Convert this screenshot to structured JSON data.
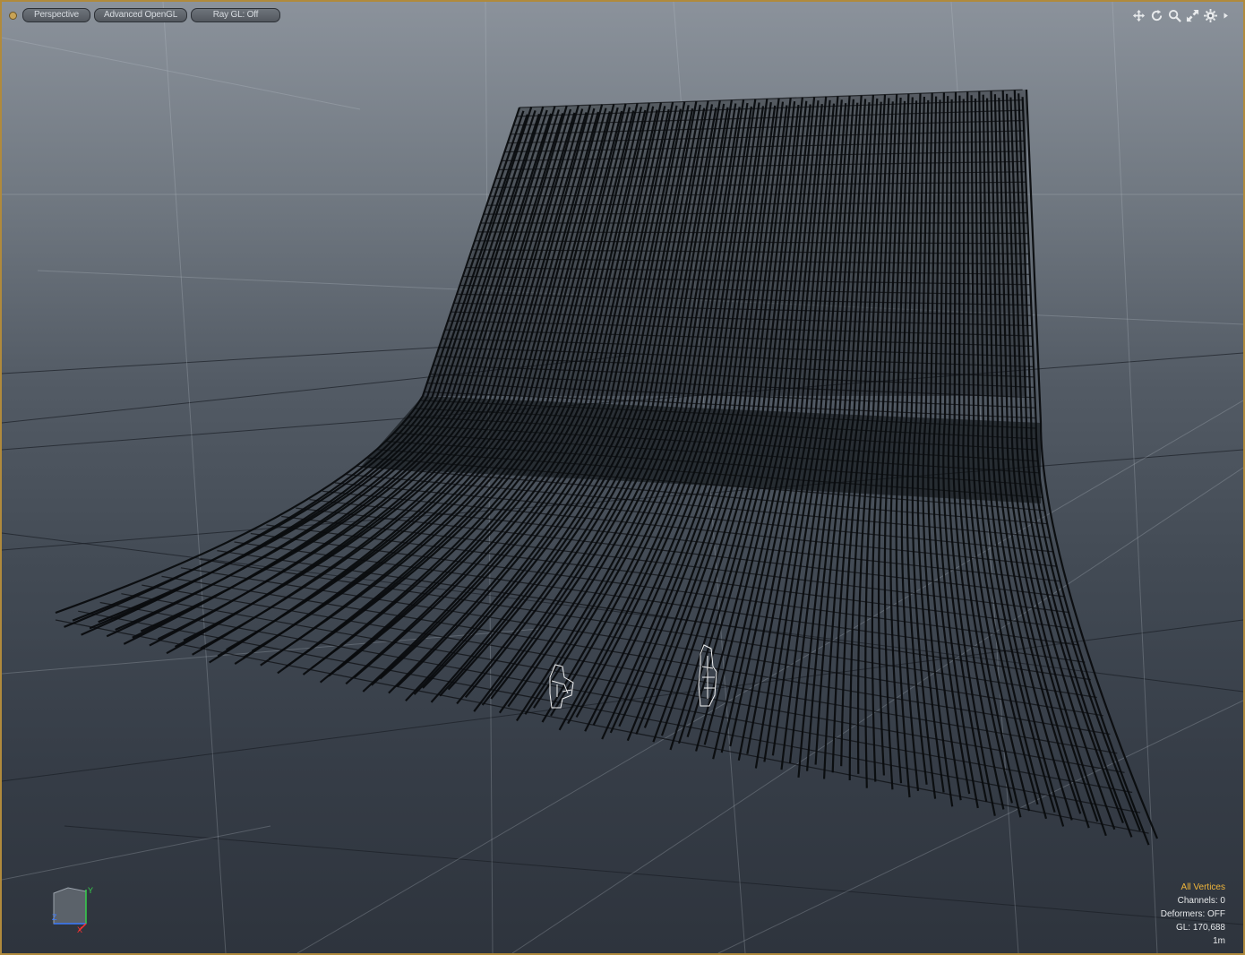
{
  "toolbar": {
    "view_mode": "Perspective",
    "shading": "Advanced OpenGL",
    "raygl": "Ray GL: Off"
  },
  "tools": [
    "move-view-icon",
    "rotate-view-icon",
    "zoom-view-icon",
    "maximize-view-icon",
    "settings-icon",
    "expand-arrow-icon"
  ],
  "info": {
    "selection_mode": "All Vertices",
    "channels": "Channels: 0",
    "deformers": "Deformers: OFF",
    "gl": "GL: 170,688",
    "scale": "1m"
  },
  "axis_gizmo": {
    "y": "Y",
    "x": "X",
    "z": "Z"
  },
  "colors": {
    "frame": "#b08a3c",
    "highlight_text": "#f0b53a",
    "mesh": "#0a0c0e",
    "grid": "#c5ccd4"
  }
}
